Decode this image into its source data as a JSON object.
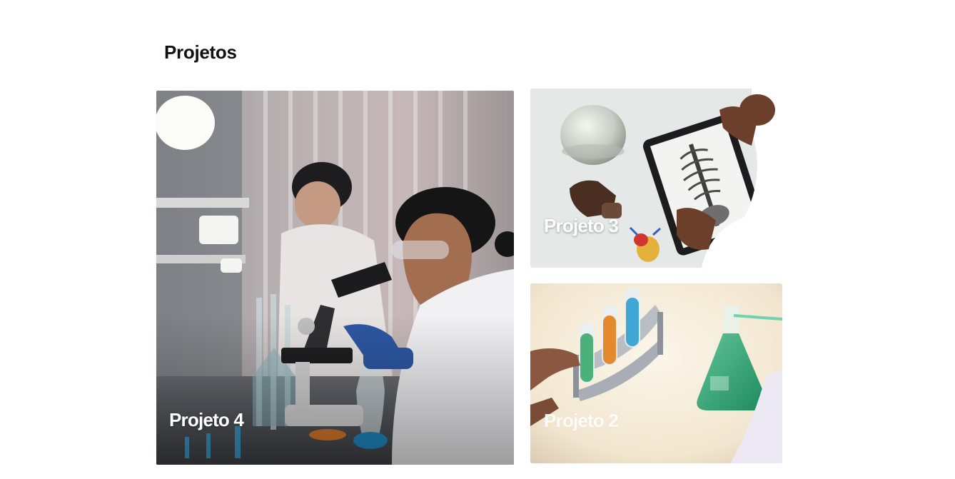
{
  "section": {
    "title": "Projetos"
  },
  "projects": [
    {
      "label": "Projeto 4",
      "image": "scientist-microscope-lab-photo"
    },
    {
      "label": "Projeto 3",
      "image": "anatomy-tablet-spine-photo"
    },
    {
      "label": "Projeto 2",
      "image": "colored-test-tubes-flask-photo"
    }
  ]
}
